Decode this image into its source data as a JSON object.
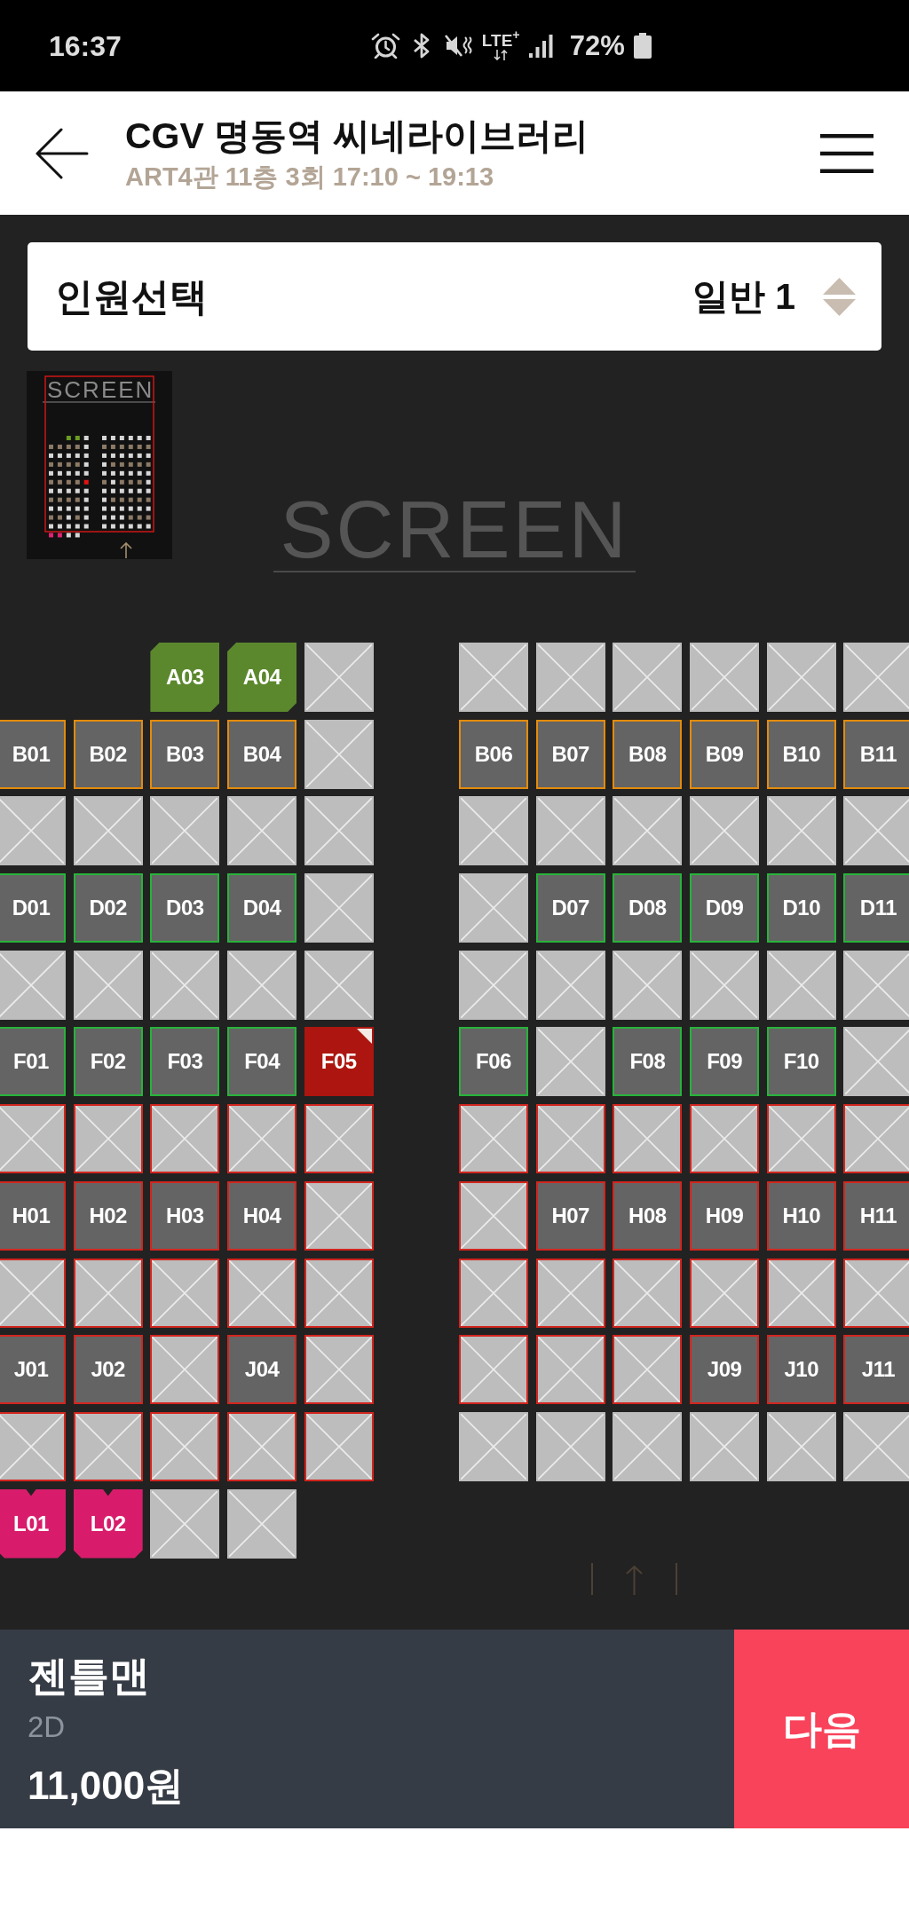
{
  "status_bar": {
    "time": "16:37",
    "network": "LTE$^{+}$",
    "battery": "72%"
  },
  "header": {
    "title": "CGV 명동역 씨네라이브러리",
    "subtitle": "ART4관 11층 3회 17:10 ~ 19:13"
  },
  "headcount": {
    "label": "인원선택",
    "value": "일반 1"
  },
  "minimap": {
    "screen_label": "SCREEN"
  },
  "screen_label": "SCREEN",
  "seat_map": {
    "rows": [
      {
        "left": [
          {
            "kind": "blank"
          },
          {
            "kind": "blank"
          },
          {
            "label": "A03",
            "kind": "corner",
            "selected": false
          },
          {
            "label": "A04",
            "kind": "corner",
            "selected": false
          },
          {
            "kind": "sold",
            "selected": false
          }
        ],
        "right": [
          {
            "kind": "sold",
            "selected": false
          },
          {
            "kind": "sold",
            "selected": false
          },
          {
            "kind": "sold",
            "selected": false
          },
          {
            "kind": "sold",
            "selected": false
          },
          {
            "kind": "sold",
            "selected": false
          },
          {
            "kind": "sold",
            "selected": false
          }
        ]
      },
      {
        "left": [
          {
            "label": "B01",
            "kind": "seat",
            "color": "#e38b0c",
            "selected": false
          },
          {
            "label": "B02",
            "kind": "seat",
            "color": "#e38b0c",
            "selected": false
          },
          {
            "label": "B03",
            "kind": "seat",
            "color": "#e38b0c",
            "selected": false
          },
          {
            "label": "B04",
            "kind": "seat",
            "color": "#e38b0c",
            "selected": false
          },
          {
            "kind": "sold",
            "selected": false
          }
        ],
        "right": [
          {
            "label": "B06",
            "kind": "seat",
            "color": "#e38b0c",
            "selected": false
          },
          {
            "label": "B07",
            "kind": "seat",
            "color": "#e38b0c",
            "selected": false
          },
          {
            "label": "B08",
            "kind": "seat",
            "color": "#e38b0c",
            "selected": false
          },
          {
            "label": "B09",
            "kind": "seat",
            "color": "#e38b0c",
            "selected": false
          },
          {
            "label": "B10",
            "kind": "seat",
            "color": "#e38b0c",
            "selected": false
          },
          {
            "label": "B11",
            "kind": "seat",
            "color": "#e38b0c",
            "selected": false
          }
        ]
      },
      {
        "left": [
          {
            "kind": "sold",
            "selected": false
          },
          {
            "kind": "sold",
            "selected": false
          },
          {
            "kind": "sold",
            "selected": false
          },
          {
            "kind": "sold",
            "selected": false
          },
          {
            "kind": "sold",
            "selected": false
          }
        ],
        "right": [
          {
            "kind": "sold",
            "selected": false
          },
          {
            "kind": "sold",
            "selected": false
          },
          {
            "kind": "sold",
            "selected": false
          },
          {
            "kind": "sold",
            "selected": false
          },
          {
            "kind": "sold",
            "selected": false
          },
          {
            "kind": "sold",
            "selected": false
          }
        ]
      },
      {
        "left": [
          {
            "label": "D01",
            "kind": "seat",
            "color": "#27b33a",
            "selected": false
          },
          {
            "label": "D02",
            "kind": "seat",
            "color": "#27b33a",
            "selected": false
          },
          {
            "label": "D03",
            "kind": "seat",
            "color": "#27b33a",
            "selected": false
          },
          {
            "label": "D04",
            "kind": "seat",
            "color": "#27b33a",
            "selected": false
          },
          {
            "kind": "sold",
            "selected": false
          }
        ],
        "right": [
          {
            "kind": "sold",
            "selected": false
          },
          {
            "label": "D07",
            "kind": "seat",
            "color": "#27b33a",
            "selected": false
          },
          {
            "label": "D08",
            "kind": "seat",
            "color": "#27b33a",
            "selected": false
          },
          {
            "label": "D09",
            "kind": "seat",
            "color": "#27b33a",
            "selected": false
          },
          {
            "label": "D10",
            "kind": "seat",
            "color": "#27b33a",
            "selected": false
          },
          {
            "label": "D11",
            "kind": "seat",
            "color": "#27b33a",
            "selected": false
          }
        ]
      },
      {
        "left": [
          {
            "kind": "sold",
            "selected": false
          },
          {
            "kind": "sold",
            "selected": false
          },
          {
            "kind": "sold",
            "selected": false
          },
          {
            "kind": "sold",
            "selected": false
          },
          {
            "kind": "sold",
            "selected": false
          }
        ],
        "right": [
          {
            "kind": "sold",
            "selected": false
          },
          {
            "kind": "sold",
            "selected": false
          },
          {
            "kind": "sold",
            "selected": false
          },
          {
            "kind": "sold",
            "selected": false
          },
          {
            "kind": "sold",
            "selected": false
          },
          {
            "kind": "sold",
            "selected": false
          }
        ]
      },
      {
        "left": [
          {
            "label": "F01",
            "kind": "seat",
            "color": "#27b33a",
            "selected": false
          },
          {
            "label": "F02",
            "kind": "seat",
            "color": "#27b33a",
            "selected": false
          },
          {
            "label": "F03",
            "kind": "seat",
            "color": "#27b33a",
            "selected": false
          },
          {
            "label": "F04",
            "kind": "seat",
            "color": "#27b33a",
            "selected": false
          },
          {
            "label": "F05",
            "kind": "seat",
            "selected": true
          }
        ],
        "right": [
          {
            "label": "F06",
            "kind": "seat",
            "color": "#27b33a",
            "selected": false
          },
          {
            "kind": "sold",
            "selected": false
          },
          {
            "label": "F08",
            "kind": "seat",
            "color": "#27b33a",
            "selected": false
          },
          {
            "label": "F09",
            "kind": "seat",
            "color": "#27b33a",
            "selected": false
          },
          {
            "label": "F10",
            "kind": "seat",
            "color": "#27b33a",
            "selected": false
          },
          {
            "kind": "sold",
            "selected": false
          }
        ]
      },
      {
        "left": [
          {
            "kind": "sold",
            "color": "#d1261f",
            "selected": false
          },
          {
            "kind": "sold",
            "color": "#d1261f",
            "selected": false
          },
          {
            "kind": "sold",
            "color": "#d1261f",
            "selected": false
          },
          {
            "kind": "sold",
            "color": "#d1261f",
            "selected": false
          },
          {
            "kind": "sold",
            "color": "#d1261f",
            "selected": false
          }
        ],
        "right": [
          {
            "kind": "sold",
            "color": "#d1261f",
            "selected": false
          },
          {
            "kind": "sold",
            "color": "#d1261f",
            "selected": false
          },
          {
            "kind": "sold",
            "color": "#d1261f",
            "selected": false
          },
          {
            "kind": "sold",
            "color": "#d1261f",
            "selected": false
          },
          {
            "kind": "sold",
            "color": "#d1261f",
            "selected": false
          },
          {
            "kind": "sold",
            "color": "#d1261f",
            "selected": false
          }
        ]
      },
      {
        "left": [
          {
            "label": "H01",
            "kind": "seat",
            "color": "#d1261f",
            "selected": false
          },
          {
            "label": "H02",
            "kind": "seat",
            "color": "#d1261f",
            "selected": false
          },
          {
            "label": "H03",
            "kind": "seat",
            "color": "#d1261f",
            "selected": false
          },
          {
            "label": "H04",
            "kind": "seat",
            "color": "#d1261f",
            "selected": false
          },
          {
            "kind": "sold",
            "color": "#d1261f",
            "selected": false
          }
        ],
        "right": [
          {
            "kind": "sold",
            "color": "#d1261f",
            "selected": false
          },
          {
            "label": "H07",
            "kind": "seat",
            "color": "#d1261f",
            "selected": false
          },
          {
            "label": "H08",
            "kind": "seat",
            "color": "#d1261f",
            "selected": false
          },
          {
            "label": "H09",
            "kind": "seat",
            "color": "#d1261f",
            "selected": false
          },
          {
            "label": "H10",
            "kind": "seat",
            "color": "#d1261f",
            "selected": false
          },
          {
            "label": "H11",
            "kind": "seat",
            "color": "#d1261f",
            "selected": false
          }
        ]
      },
      {
        "left": [
          {
            "kind": "sold",
            "color": "#d1261f",
            "selected": false
          },
          {
            "kind": "sold",
            "color": "#d1261f",
            "selected": false
          },
          {
            "kind": "sold",
            "color": "#d1261f",
            "selected": false
          },
          {
            "kind": "sold",
            "color": "#d1261f",
            "selected": false
          },
          {
            "kind": "sold",
            "color": "#d1261f",
            "selected": false
          }
        ],
        "right": [
          {
            "kind": "sold",
            "color": "#d1261f",
            "selected": false
          },
          {
            "kind": "sold",
            "color": "#d1261f",
            "selected": false
          },
          {
            "kind": "sold",
            "color": "#d1261f",
            "selected": false
          },
          {
            "kind": "sold",
            "color": "#d1261f",
            "selected": false
          },
          {
            "kind": "sold",
            "color": "#d1261f",
            "selected": false
          },
          {
            "kind": "sold",
            "color": "#d1261f",
            "selected": false
          }
        ]
      },
      {
        "left": [
          {
            "label": "J01",
            "kind": "seat",
            "color": "#d1261f",
            "selected": false
          },
          {
            "label": "J02",
            "kind": "seat",
            "color": "#d1261f",
            "selected": false
          },
          {
            "kind": "sold",
            "color": "#d1261f",
            "selected": false
          },
          {
            "label": "J04",
            "kind": "seat",
            "color": "#d1261f",
            "selected": false
          },
          {
            "kind": "sold",
            "color": "#d1261f",
            "selected": false
          }
        ],
        "right": [
          {
            "kind": "sold",
            "color": "#d1261f",
            "selected": false
          },
          {
            "kind": "sold",
            "color": "#d1261f",
            "selected": false
          },
          {
            "kind": "sold",
            "color": "#d1261f",
            "selected": false
          },
          {
            "label": "J09",
            "kind": "seat",
            "color": "#d1261f",
            "selected": false
          },
          {
            "label": "J10",
            "kind": "seat",
            "color": "#d1261f",
            "selected": false
          },
          {
            "label": "J11",
            "kind": "seat",
            "color": "#d1261f",
            "selected": false
          }
        ]
      },
      {
        "left": [
          {
            "kind": "sold",
            "color": "#d1261f",
            "selected": false
          },
          {
            "kind": "sold",
            "color": "#d1261f",
            "selected": false
          },
          {
            "kind": "sold",
            "color": "#d1261f",
            "selected": false
          },
          {
            "kind": "sold",
            "color": "#d1261f",
            "selected": false
          },
          {
            "kind": "sold",
            "color": "#d1261f",
            "selected": false
          }
        ],
        "right": [
          {
            "kind": "sold",
            "selected": false
          },
          {
            "kind": "sold",
            "selected": false
          },
          {
            "kind": "sold",
            "selected": false
          },
          {
            "kind": "sold",
            "selected": false
          },
          {
            "kind": "sold",
            "selected": false
          },
          {
            "kind": "sold",
            "selected": false
          }
        ]
      },
      {
        "left": [
          {
            "label": "L01",
            "kind": "notch",
            "selected": false
          },
          {
            "label": "L02",
            "kind": "notch",
            "selected": false
          },
          {
            "kind": "sold",
            "selected": false
          },
          {
            "kind": "sold",
            "selected": false
          }
        ]
      }
    ]
  },
  "summary": {
    "title": "젠틀맨",
    "format": "2D",
    "price": "11,000원"
  },
  "next_button": "다음"
}
